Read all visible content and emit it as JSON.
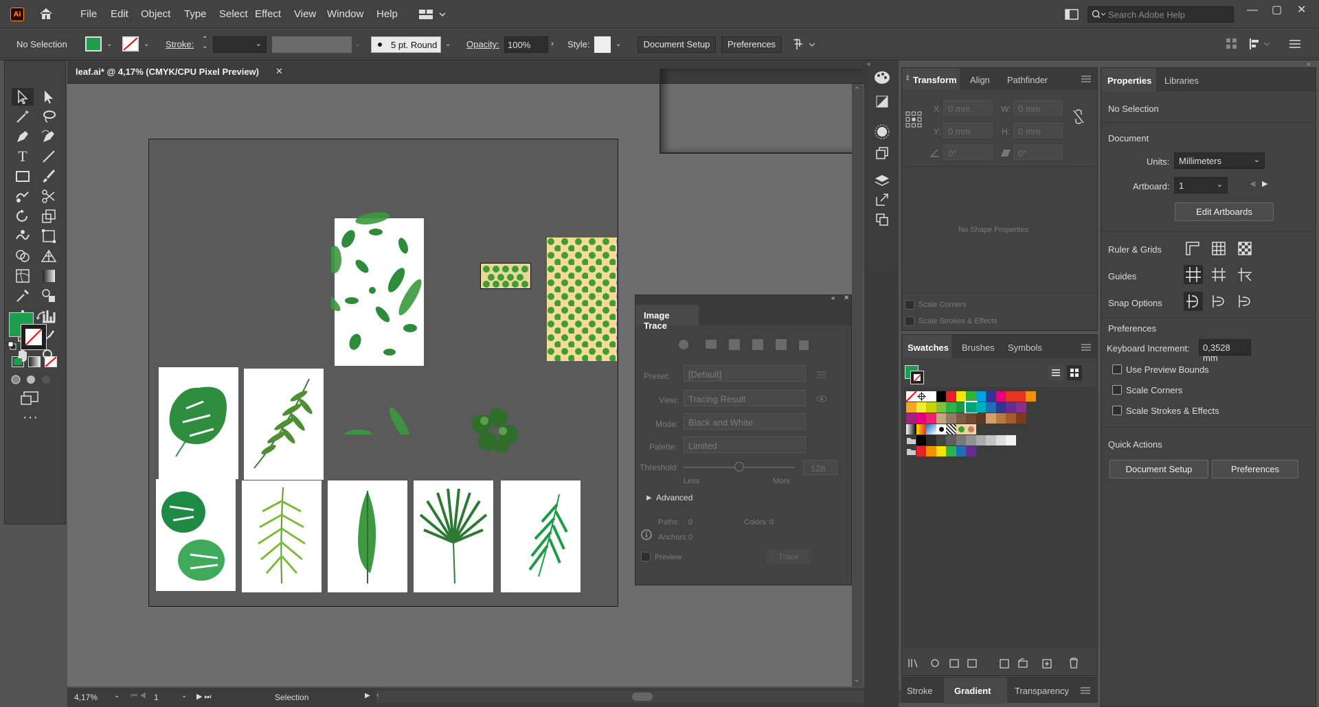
{
  "app": {
    "logo": "Ai"
  },
  "menu": [
    "File",
    "Edit",
    "Object",
    "Type",
    "Select",
    "Effect",
    "View",
    "Window",
    "Help"
  ],
  "search": {
    "placeholder": "Search Adobe Help"
  },
  "control": {
    "selection": "No Selection",
    "stroke_label": "Stroke:",
    "brush": "5 pt. Round",
    "opacity_label": "Opacity:",
    "opacity": "100%",
    "style_label": "Style:",
    "doc_setup": "Document Setup",
    "preferences": "Preferences",
    "fill_color": "#1e9d4e"
  },
  "document": {
    "tab_title": "leaf.ai* @ 4,17% (CMYK/CPU Pixel Preview)",
    "close": "✕"
  },
  "status": {
    "zoom": "4,17%",
    "artboard": "1",
    "tool": "Selection"
  },
  "transform_panel": {
    "tabs": [
      "Transform",
      "Align",
      "Pathfinder"
    ],
    "x_label": "X:",
    "x": "0 mm",
    "y_label": "Y:",
    "y": "0 mm",
    "w_label": "W:",
    "w": "0 mm",
    "h_label": "H:",
    "h": "0 mm",
    "angle": "0°",
    "shear": "0°",
    "no_shape": "No Shape Properties",
    "scale_corners": "Scale Corners",
    "scale_strokes": "Scale Strokes & Effects"
  },
  "swatches_panel": {
    "tabs": [
      "Swatches",
      "Brushes",
      "Symbols"
    ]
  },
  "bottom_tabs": [
    "Stroke",
    "Gradient",
    "Transparency"
  ],
  "image_trace": {
    "title": "Image Trace",
    "preset_label": "Preset:",
    "preset": "[Default]",
    "view_label": "View:",
    "view": "Tracing Result",
    "mode_label": "Mode:",
    "mode": "Black and White",
    "palette_label": "Palette:",
    "palette": "Limited",
    "threshold_label": "Threshold:",
    "threshold": "128",
    "less": "Less",
    "more": "More",
    "advanced": "Advanced",
    "paths_label": "Paths:",
    "paths": "0",
    "colors_label": "Colors:",
    "colors": "0",
    "anchors_label": "Anchors:",
    "anchors": "0",
    "preview": "Preview",
    "trace": "Trace"
  },
  "properties": {
    "tabs": [
      "Properties",
      "Libraries"
    ],
    "no_selection": "No Selection",
    "document": "Document",
    "units_label": "Units:",
    "units": "Millimeters",
    "artboard_label": "Artboard:",
    "artboard": "1",
    "edit_artboards": "Edit Artboards",
    "ruler_grids": "Ruler & Grids",
    "guides": "Guides",
    "snap_options": "Snap Options",
    "preferences": "Preferences",
    "keyboard_increment_label": "Keyboard Increment:",
    "keyboard_increment": "0,3528 mm",
    "use_preview_bounds": "Use Preview Bounds",
    "scale_corners": "Scale Corners",
    "scale_strokes": "Scale Strokes & Effects",
    "quick_actions": "Quick Actions",
    "doc_setup": "Document Setup",
    "pref_button": "Preferences"
  }
}
